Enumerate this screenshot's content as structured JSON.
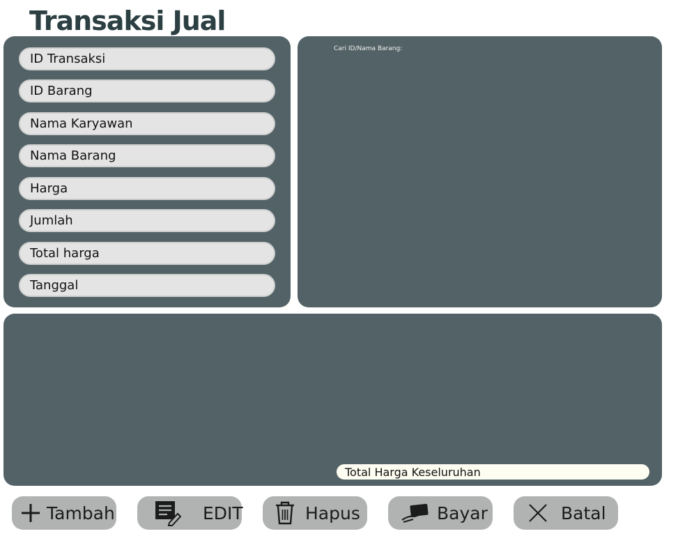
{
  "title": "Transaksi Jual",
  "form": {
    "fields": [
      {
        "label": "ID Transaksi"
      },
      {
        "label": "ID Barang"
      },
      {
        "label": "Nama Karyawan"
      },
      {
        "label": "Nama Barang"
      },
      {
        "label": "Harga"
      },
      {
        "label": "Jumlah"
      },
      {
        "label": "Total harga"
      },
      {
        "label": "Tanggal"
      }
    ]
  },
  "search": {
    "label": "Cari ID/Nama Barang:"
  },
  "table": {
    "total_label": "Total Harga Keseluruhan"
  },
  "buttons": {
    "tambah": {
      "label": "Tambah",
      "icon": "plus-icon"
    },
    "edit": {
      "label": "EDIT",
      "icon": "edit-icon"
    },
    "hapus": {
      "label": "Hapus",
      "icon": "trash-icon"
    },
    "bayar": {
      "label": "Bayar",
      "icon": "payment-icon"
    },
    "batal": {
      "label": "Batal",
      "icon": "close-icon"
    }
  },
  "colors": {
    "panel": "#526266",
    "field": "#e4e4e4",
    "button": "#b1b3b3",
    "title": "#2c3f43",
    "total_field": "#fdfdf1"
  }
}
